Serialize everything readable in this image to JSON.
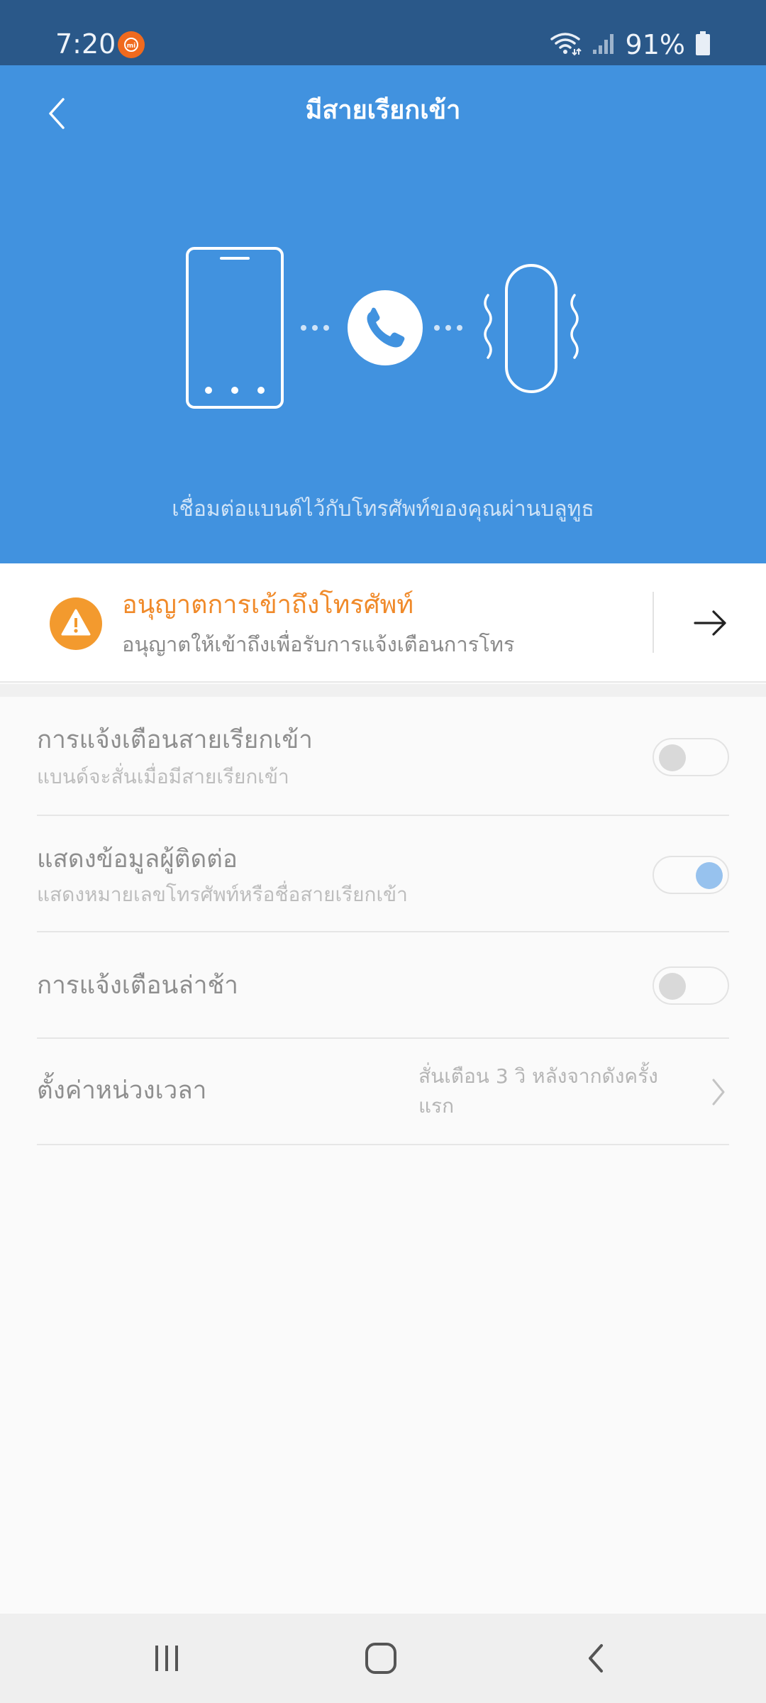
{
  "status_bar": {
    "time": "7:20",
    "battery": "91%"
  },
  "header": {
    "title": "มีสายเรียกเข้า",
    "caption": "เชื่อมต่อแบนด์ไว้กับโทรศัพท์ของคุณผ่านบลูทูธ"
  },
  "permission": {
    "title": "อนุญาตการเข้าถึงโทรศัพท์",
    "subtitle": "อนุญาตให้เข้าถึงเพื่อรับการแจ้งเตือนการโทร"
  },
  "settings": {
    "incoming_call_alert": {
      "title": "การแจ้งเตือนสายเรียกเข้า",
      "subtitle": "แบนด์จะสั่นเมื่อมีสายเรียกเข้า",
      "enabled": false
    },
    "show_contact_info": {
      "title": "แสดงข้อมูลผู้ติดต่อ",
      "subtitle": "แสดงหมายเลขโทรศัพท์หรือชื่อสายเรียกเข้า",
      "enabled": true
    },
    "delayed_alert": {
      "title": "การแจ้งเตือนล่าช้า",
      "enabled": false
    },
    "delay_setting": {
      "title": "ตั้งค่าหน่วงเวลา",
      "value": "สั่นเตือน 3 วิ หลังจากดังครั้งแรก"
    }
  },
  "colors": {
    "header_bg": "#4192df",
    "status_bg": "#2a5889",
    "accent_orange": "#f39a2e",
    "toggle_on": "#97c2ee"
  }
}
